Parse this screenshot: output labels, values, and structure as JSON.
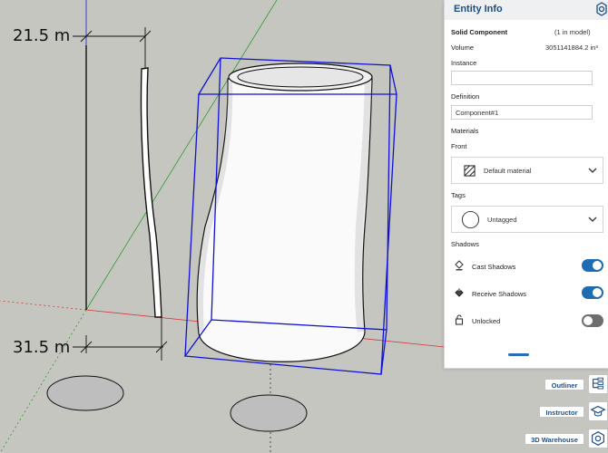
{
  "viewport": {
    "dimension_top": "21.5 m",
    "dimension_bottom": "31.5 m",
    "colors": {
      "background": "#c6c6c1",
      "selection_box": "#1010d8",
      "axis_red": "#d23a3a",
      "axis_green": "#2e9b2e",
      "axis_blue": "#1a1ad6"
    }
  },
  "panel": {
    "title": "Entity Info",
    "header_icon": "gear-icon",
    "entity_type": "Solid Component",
    "model_count": "(1 in model)",
    "volume_label": "Volume",
    "volume_value": "3051141884.2 in³",
    "instance_label": "Instance",
    "instance_value": "",
    "definition_label": "Definition",
    "definition_value": "Component#1",
    "materials_label": "Materials",
    "front_label": "Front",
    "material_value": "Default material",
    "tags_label": "Tags",
    "tag_value": "Untagged",
    "shadows_label": "Shadows",
    "cast_shadows_label": "Cast Shadows",
    "cast_shadows_on": true,
    "receive_shadows_label": "Receive Shadows",
    "receive_shadows_on": true,
    "lock_label": "Unlocked",
    "locked": false,
    "accent_color": "#1e6cb2"
  },
  "side_buttons": [
    {
      "label": "Outliner",
      "icon": "outliner-icon"
    },
    {
      "label": "Instructor",
      "icon": "instructor-icon"
    },
    {
      "label": "3D Warehouse",
      "icon": "warehouse-icon"
    }
  ]
}
